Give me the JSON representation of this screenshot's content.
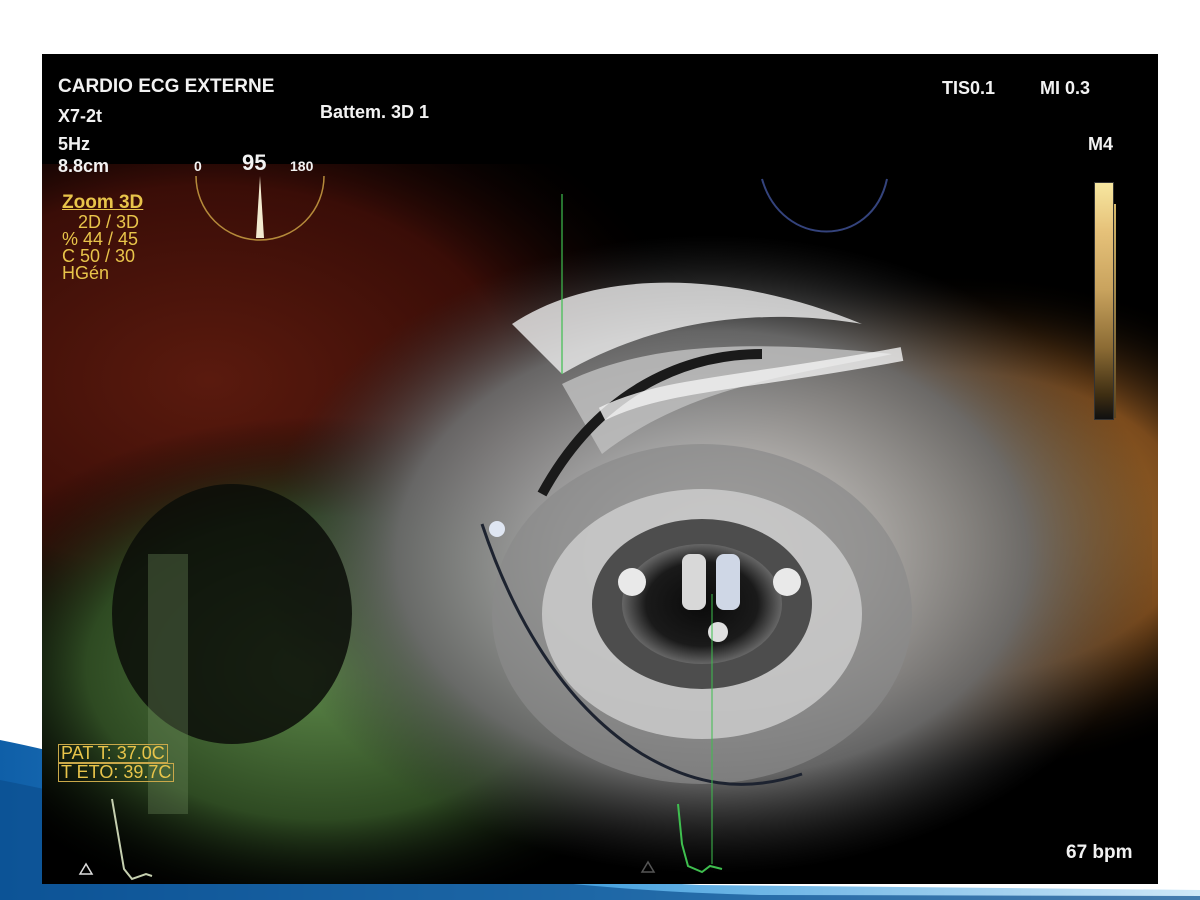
{
  "header": {
    "preset": "CARDIO ECG EXTERNE",
    "probe": "X7-2t",
    "frequency": "5Hz",
    "depth": "8.8cm",
    "mode_label": "Battem. 3D 1",
    "tis": "TIS0.1",
    "mi": "MI 0.3",
    "map": "M4"
  },
  "angle_indicator": {
    "min": "0",
    "value": "95",
    "max": "180",
    "angle_value": 95
  },
  "zoom_panel": {
    "title": "Zoom 3D",
    "lines": [
      "2D / 3D",
      "% 44 / 45",
      "C  50 / 30",
      "HGén"
    ]
  },
  "temperatures": {
    "patient": "PAT T: 37.0C",
    "probe": "T ETO: 39.7C"
  },
  "heart_rate": "67 bpm",
  "colors": {
    "hud_text": "#f2f2f2",
    "accent_yellow": "#e8c44a",
    "ecg_trace": "#3fbf4f",
    "swoosh_blue": "#1e6fb8"
  }
}
